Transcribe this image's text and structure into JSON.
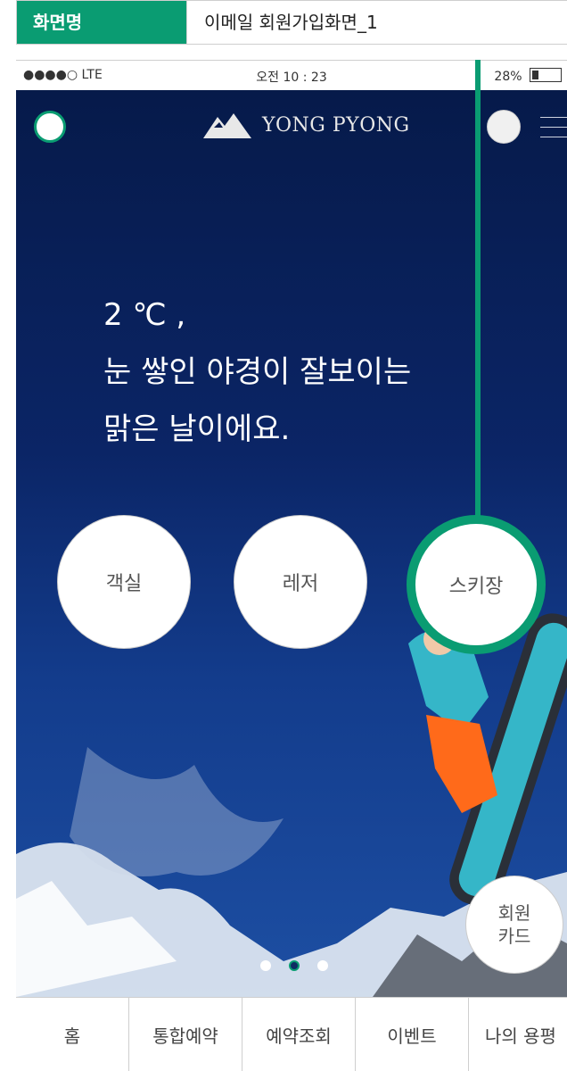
{
  "header": {
    "label": "화면명",
    "value": "이메일 회원가입화면_1"
  },
  "status": {
    "signal": "●●●●○ LTE",
    "time": "오전 10 : 23",
    "battery": "28%"
  },
  "app": {
    "logo_text": "YONG PYONG"
  },
  "weather": {
    "line1": "2 ℃ ,",
    "line2": "눈 쌓인 야경이 잘보이는",
    "line3": "맑은 날이에요."
  },
  "categories": [
    {
      "label": "객실"
    },
    {
      "label": "레저"
    },
    {
      "label": "스키장"
    }
  ],
  "member_card": {
    "line1": "회원",
    "line2": "카드"
  },
  "carousel": {
    "total": 3,
    "active_indexes": [
      0,
      2
    ]
  },
  "tabs": [
    {
      "label": "홈"
    },
    {
      "label": "통합예약"
    },
    {
      "label": "예약조회"
    },
    {
      "label": "이벤트"
    },
    {
      "label": "나의 용평"
    }
  ],
  "colors": {
    "accent": "#0a9c72",
    "hero_bg": "#071a4a"
  }
}
